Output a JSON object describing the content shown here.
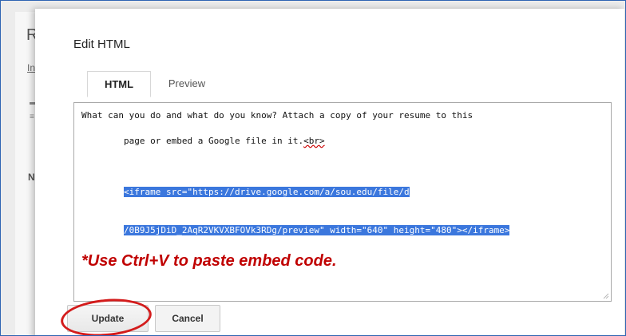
{
  "background": {
    "letter_r": "R",
    "letter_in": "In",
    "letter_n": "N",
    "mark_1": "▬",
    "mark_2": "≡"
  },
  "dialog": {
    "title": "Edit HTML",
    "tabs": [
      "HTML",
      "Preview"
    ],
    "active_tab": "HTML",
    "editor": {
      "line1": "What can you do and what do you know? Attach a copy of your resume to this",
      "line2_prefix": "page or embed a Google file in it.",
      "line2_tag": "<br>",
      "selected_line1": "<iframe src=\"https://drive.google.com/a/sou.edu/file/d",
      "selected_line2": "/0B9J5jDiD_2AqR2VKVXBFOVk3RDg/preview\" width=\"640\" height=\"480\"></iframe>",
      "instruction": "*Use Ctrl+V to paste embed code."
    },
    "buttons": {
      "update": "Update",
      "cancel": "Cancel"
    }
  },
  "colors": {
    "selection": "#3b77dd",
    "instruction": "#c00000",
    "highlight_ring": "#d31b1b",
    "frame_border": "#2f64b2"
  }
}
